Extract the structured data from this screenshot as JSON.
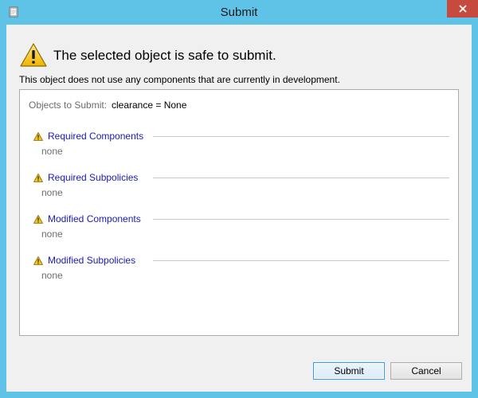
{
  "window": {
    "title": "Submit",
    "icon": "document-icon",
    "close_icon": "close-icon",
    "title_bar_color": "#5fc3e8",
    "close_button_color": "#c74a3e"
  },
  "header": {
    "icon": "warning-icon",
    "message": "The selected object is safe to submit.",
    "detail": "This object does not use any components that are currently in development."
  },
  "panel": {
    "objects_label": "Objects to Submit:",
    "objects_value": "clearance = None",
    "sections": [
      {
        "title": "Required Components",
        "value": "none",
        "icon": "warning-icon"
      },
      {
        "title": "Required Subpolicies",
        "value": "none",
        "icon": "warning-icon"
      },
      {
        "title": "Modified Components",
        "value": "none",
        "icon": "warning-icon"
      },
      {
        "title": "Modified Subpolicies",
        "value": "none",
        "icon": "warning-icon"
      }
    ],
    "link_color": "#1a1ab8"
  },
  "buttons": {
    "submit_label": "Submit",
    "cancel_label": "Cancel"
  }
}
